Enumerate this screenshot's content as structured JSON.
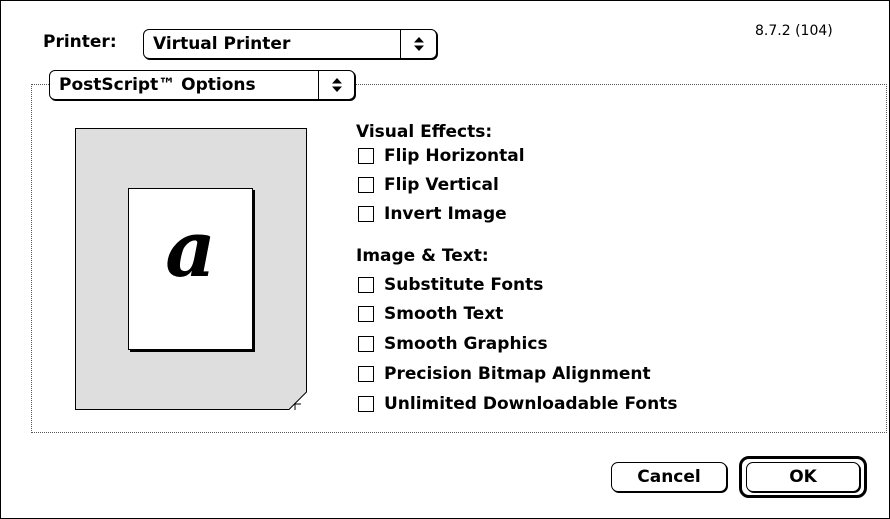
{
  "dialog": {
    "version": "8.7.2 (104)",
    "printer_label": "Printer:",
    "printer_value": "Virtual Printer",
    "options_value": "PostScript™ Options"
  },
  "preview": {
    "letter": "a"
  },
  "visual_effects": {
    "title": "Visual Effects:",
    "items": [
      {
        "label": "Flip Horizontal",
        "checked": false
      },
      {
        "label": "Flip Vertical",
        "checked": false
      },
      {
        "label": "Invert Image",
        "checked": false
      }
    ]
  },
  "image_text": {
    "title": "Image & Text:",
    "items": [
      {
        "label": "Substitute Fonts",
        "checked": false
      },
      {
        "label": "Smooth Text",
        "checked": false
      },
      {
        "label": "Smooth Graphics",
        "checked": false
      },
      {
        "label": "Precision Bitmap Alignment",
        "checked": false
      },
      {
        "label": "Unlimited Downloadable Fonts",
        "checked": false
      }
    ]
  },
  "buttons": {
    "cancel": "Cancel",
    "ok": "OK"
  },
  "icons": {
    "popup_arrow": "up-down-arrows-icon",
    "page_corner": "page-dogear-icon"
  }
}
